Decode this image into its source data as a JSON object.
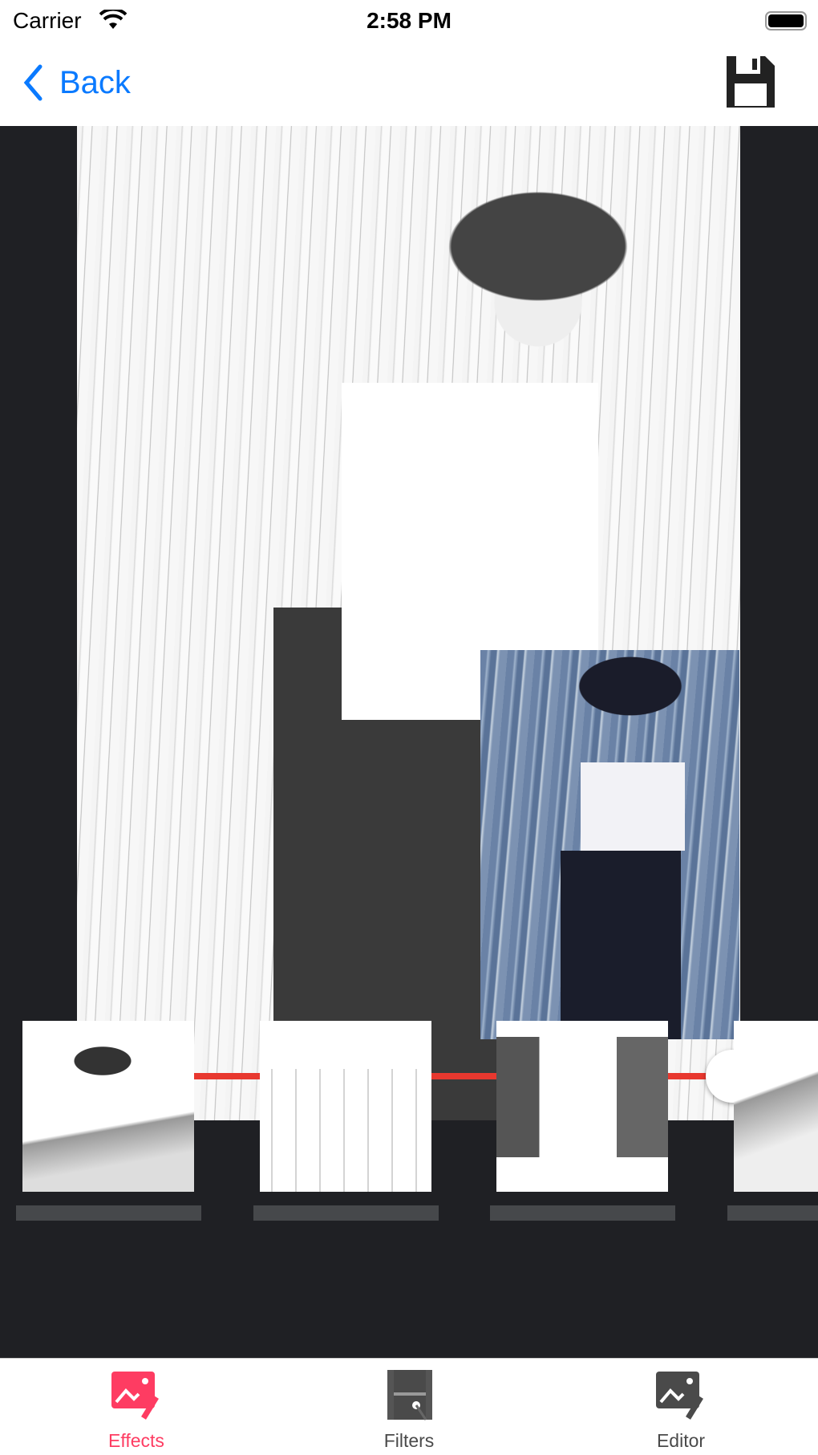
{
  "status_bar": {
    "carrier": "Carrier",
    "time": "2:58 PM",
    "battery_level": 1.0
  },
  "nav": {
    "back_label": "Back",
    "save_icon": "floppy-disk-icon"
  },
  "editor": {
    "slider_value": 1.0,
    "slider_color": "#e8382f"
  },
  "thumbnails": [
    {
      "label": ""
    },
    {
      "label": ""
    },
    {
      "label": ""
    },
    {
      "label": ""
    }
  ],
  "tabs": [
    {
      "label": "Effects",
      "icon": "image-edit-icon",
      "active": true,
      "color": "#fe3c62"
    },
    {
      "label": "Filters",
      "icon": "film-magic-icon",
      "active": false
    },
    {
      "label": "Editor",
      "icon": "image-edit-icon",
      "active": false
    }
  ]
}
